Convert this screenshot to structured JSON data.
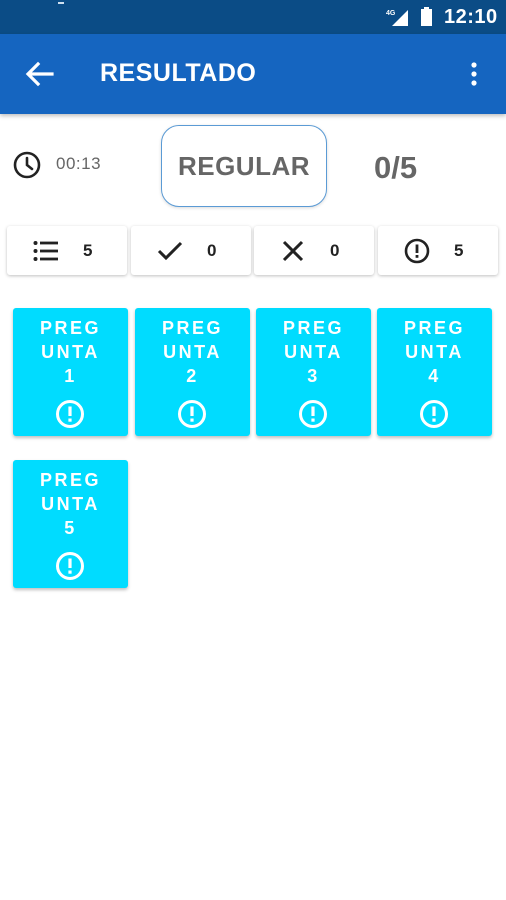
{
  "status_bar": {
    "time": "12:10",
    "network": "4G"
  },
  "app_bar": {
    "title": "RESULTADO",
    "back_icon": "arrow-back-icon",
    "menu_icon": "more-vert-icon"
  },
  "summary": {
    "timer": "00:13",
    "grade": "REGULAR",
    "score": "0/5"
  },
  "stats": {
    "total": {
      "icon": "list-icon",
      "value": "5"
    },
    "correct": {
      "icon": "check-icon",
      "value": "0"
    },
    "wrong": {
      "icon": "close-icon",
      "value": "0"
    },
    "unanswered": {
      "icon": "alert-circle-icon",
      "value": "5"
    }
  },
  "questions": [
    {
      "lines": [
        "PREG",
        "UNTA",
        "1"
      ]
    },
    {
      "lines": [
        "PREG",
        "UNTA",
        "2"
      ]
    },
    {
      "lines": [
        "PREG",
        "UNTA",
        "3"
      ]
    },
    {
      "lines": [
        "PREG",
        "UNTA",
        "4"
      ]
    },
    {
      "lines": [
        "PREG",
        "UNTA",
        "5"
      ]
    }
  ],
  "colors": {
    "status_bar": "#0b4c86",
    "app_bar": "#1565c0",
    "card": "#00dcff",
    "grade_border": "#5b9bd5"
  }
}
